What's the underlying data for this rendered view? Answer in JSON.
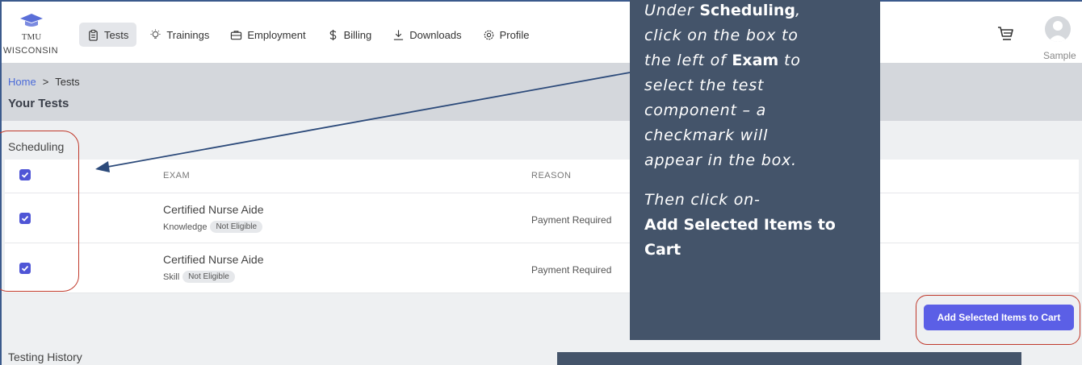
{
  "logo": {
    "line1": "TMU",
    "line2": "WISCONSIN"
  },
  "nav": {
    "items": [
      {
        "label": "Tests",
        "icon": "clipboard-icon",
        "active": true
      },
      {
        "label": "Trainings",
        "icon": "lightbulb-icon",
        "active": false
      },
      {
        "label": "Employment",
        "icon": "briefcase-icon",
        "active": false
      },
      {
        "label": "Billing",
        "icon": "dollar-icon",
        "active": false
      },
      {
        "label": "Downloads",
        "icon": "download-icon",
        "active": false
      },
      {
        "label": "Profile",
        "icon": "gear-icon",
        "active": false
      }
    ]
  },
  "user": {
    "name": "Sample"
  },
  "breadcrumb": {
    "home": "Home",
    "separator": ">",
    "current": "Tests"
  },
  "page_title": "Your Tests",
  "scheduling": {
    "label": "Scheduling",
    "columns": {
      "exam": "EXAM",
      "reason": "REASON"
    },
    "rows": [
      {
        "exam": "Certified Nurse Aide",
        "component": "Knowledge",
        "status": "Not Eligible",
        "reason": "Payment Required",
        "checked": true
      },
      {
        "exam": "Certified Nurse Aide",
        "component": "Skill",
        "status": "Not Eligible",
        "reason": "Payment Required",
        "checked": true
      }
    ]
  },
  "add_button": "Add Selected Items to Cart",
  "testing_history": "Testing History",
  "callout": {
    "line1_italic": "Under ",
    "line1_bold": "Scheduling",
    "line1_end": ",",
    "line2": "click on the box to",
    "line3_italic": "the left of ",
    "line3_bold": "Exam",
    "line3_end": " to",
    "line4": "select the test",
    "line5": "component – a",
    "line6": "checkmark will",
    "line7": "appear in the box.",
    "line8": "Then click on-",
    "line9": "Add Selected Items to",
    "line10": "Cart"
  },
  "colors": {
    "accent": "#5b5fe6",
    "callout_bg": "#44546a",
    "annotation_red": "#c0392b",
    "arrow": "#2c4a7a"
  }
}
